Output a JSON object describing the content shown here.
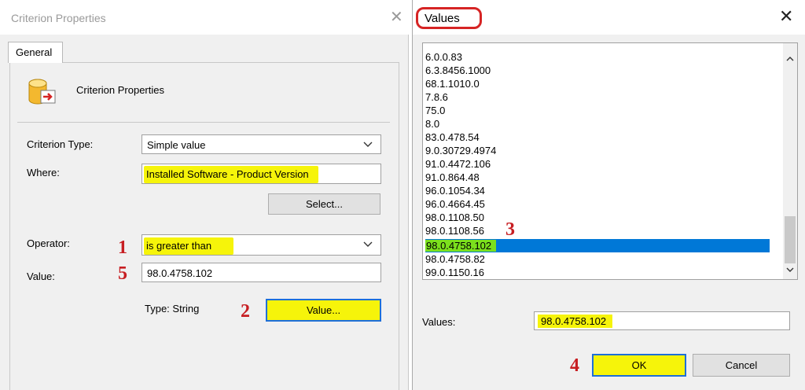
{
  "criterion": {
    "title": "Criterion Properties",
    "tab": "General",
    "header": "Criterion Properties",
    "criterion_type_label": "Criterion Type:",
    "criterion_type_value": "Simple value",
    "where_label": "Where:",
    "where_value": "Installed Software - Product Version",
    "select_button": "Select...",
    "operator_label": "Operator:",
    "operator_value": "is greater than",
    "value_label": "Value:",
    "value_value": "98.0.4758.102",
    "type_text": "Type: String",
    "value_button": "Value..."
  },
  "values_dialog": {
    "title": "Values",
    "items": [
      "6.0.0.83",
      "6.3.8456.1000",
      "68.1.1010.0",
      "7.8.6",
      "75.0",
      "8.0",
      "83.0.478.54",
      "9.0.30729.4974",
      "91.0.4472.106",
      "91.0.864.48",
      "96.0.1054.34",
      "96.0.4664.45",
      "98.0.1108.50",
      "98.0.1108.56",
      "98.0.4758.102",
      "98.0.4758.82",
      "99.0.1150.16"
    ],
    "selected_item": "98.0.4758.102",
    "values_label": "Values:",
    "values_field": "98.0.4758.102",
    "ok_button": "OK",
    "cancel_button": "Cancel"
  },
  "annotations": {
    "n1": "1",
    "n2": "2",
    "n3": "3",
    "n4": "4",
    "n5": "5"
  },
  "colors": {
    "highlight_yellow": "#f6f40a",
    "selection_blue": "#0078d7",
    "selection_green": "#7be01d",
    "annotation_red": "#c71e22"
  }
}
